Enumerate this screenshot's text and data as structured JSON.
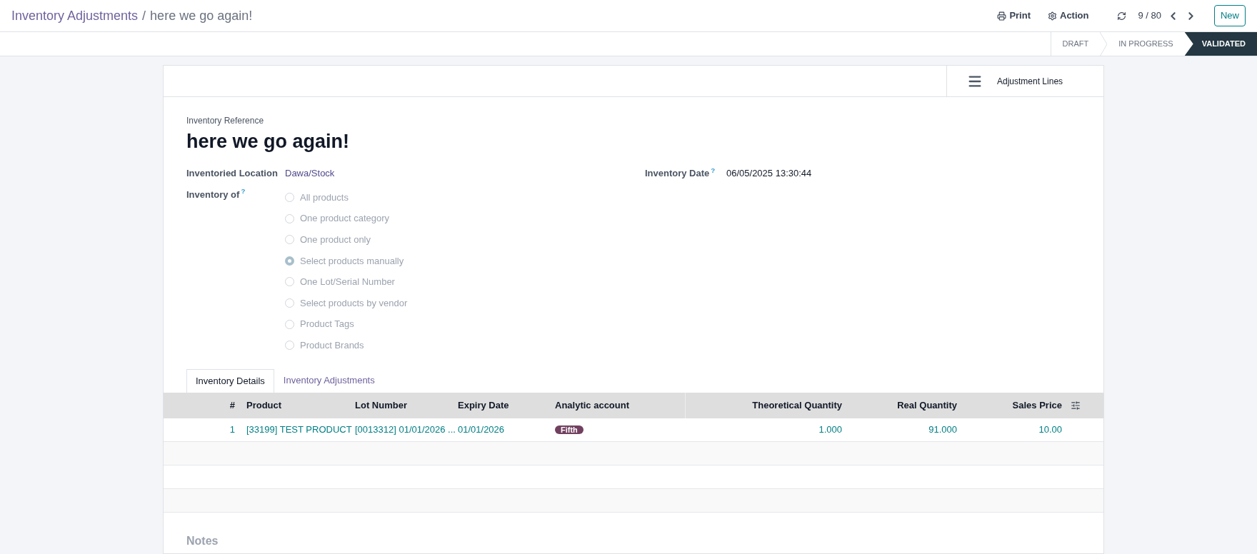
{
  "breadcrumb": {
    "parent": "Inventory Adjustments",
    "separator": "/",
    "current": "here we go again!"
  },
  "toolbar": {
    "print": "Print",
    "action": "Action",
    "pager": "9 / 80",
    "new_button": "New"
  },
  "status_steps": [
    {
      "label": "DRAFT",
      "selected": false
    },
    {
      "label": "IN PROGRESS",
      "selected": false
    },
    {
      "label": "VALIDATED",
      "selected": true
    }
  ],
  "smart_button": {
    "label": "Adjustment Lines"
  },
  "form": {
    "reference_label": "Inventory Reference",
    "reference": "here we go again!",
    "location_label": "Inventoried Location",
    "location": "Dawa/Stock",
    "date_label": "Inventory Date",
    "date_help": "?",
    "date": "06/05/2025 13:30:44",
    "inventory_of_label": "Inventory of",
    "inventory_of_help": "?",
    "options": [
      {
        "label": "All products",
        "selected": false,
        "disabled": true
      },
      {
        "label": "One product category",
        "selected": false,
        "disabled": true
      },
      {
        "label": "One product only",
        "selected": false,
        "disabled": true
      },
      {
        "label": "Select products manually",
        "selected": true,
        "disabled": true
      },
      {
        "label": "One Lot/Serial Number",
        "selected": false,
        "disabled": true
      },
      {
        "label": "Select products by vendor",
        "selected": false,
        "disabled": true
      },
      {
        "label": "Product Tags",
        "selected": false,
        "disabled": true
      },
      {
        "label": "Product Brands",
        "selected": false,
        "disabled": true
      }
    ]
  },
  "tabs": [
    {
      "label": "Inventory Details",
      "selected": true
    },
    {
      "label": "Inventory Adjustments",
      "selected": false
    }
  ],
  "table": {
    "columns": [
      {
        "label": "#"
      },
      {
        "label": "Product"
      },
      {
        "label": "Lot Number"
      },
      {
        "label": "Expiry Date"
      },
      {
        "label": "Analytic account"
      },
      {
        "label": "Theoretical Quantity"
      },
      {
        "label": "Real Quantity"
      },
      {
        "label": "Sales Price"
      }
    ],
    "rows": [
      {
        "cells": [
          {
            "kind": "text",
            "text": "1"
          },
          {
            "kind": "text",
            "text": "[33199] TEST PRODUCT"
          },
          {
            "kind": "text",
            "text": "[0013312] 01/01/2026 ..."
          },
          {
            "kind": "text",
            "text": "01/01/2026"
          },
          {
            "kind": "tag",
            "text": "Fifth",
            "color": "#71405f"
          },
          {
            "kind": "text",
            "text": "1.000"
          },
          {
            "kind": "text",
            "text": "91.000"
          },
          {
            "kind": "text",
            "text": "10.00"
          }
        ]
      }
    ]
  },
  "notes_label": "Notes"
}
